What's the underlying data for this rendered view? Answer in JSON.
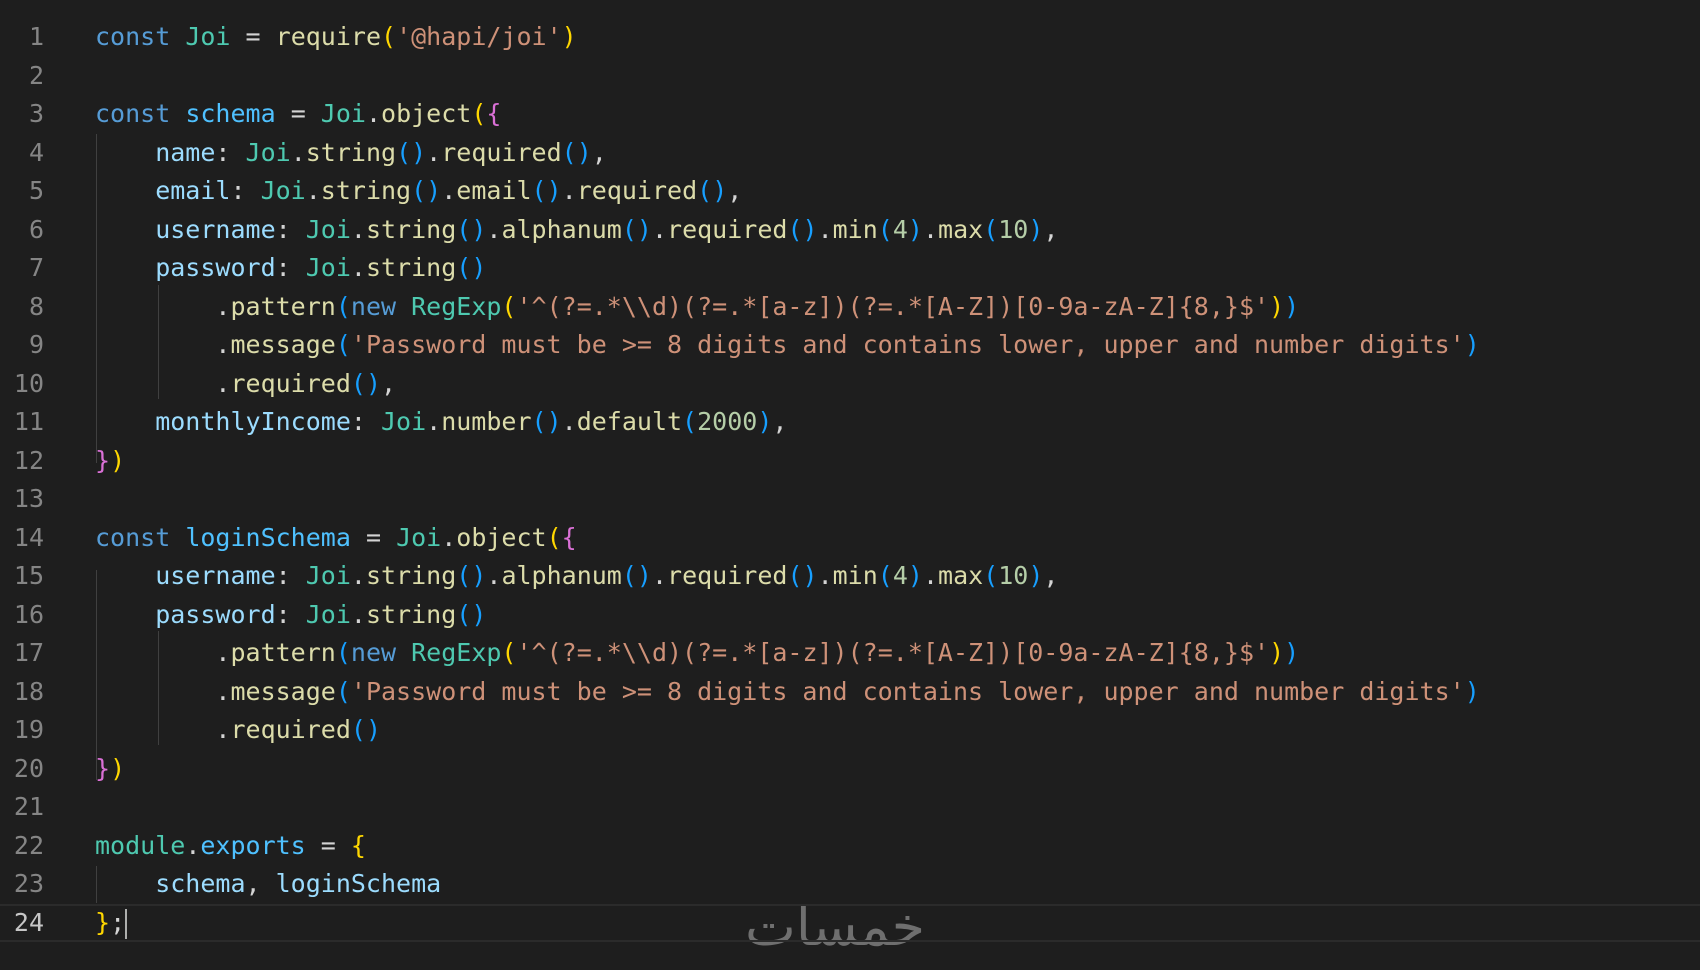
{
  "colors": {
    "background": "#1e1e1e",
    "line_number": "#858585",
    "keyword": "#569cd6",
    "variable": "#9cdcfe",
    "class": "#4ec9b0",
    "function": "#dcdcaa",
    "string": "#ce9178",
    "number": "#b5cea8",
    "text": "#d4d4d4",
    "bracket1": "#ffd700",
    "bracket2": "#da70d6",
    "bracket3": "#179fff"
  },
  "editor": {
    "current_line": 24,
    "lines": [
      {
        "n": "1",
        "t": [
          [
            "const",
            "#569cd6"
          ],
          [
            " ",
            "#d4d4d4"
          ],
          [
            "Joi",
            "#4ec9b0"
          ],
          [
            " = ",
            "#d4d4d4"
          ],
          [
            "require",
            "#dcdcaa"
          ],
          [
            "(",
            "#ffd700"
          ],
          [
            "'@hapi/joi'",
            "#ce9178"
          ],
          [
            ")",
            "#ffd700"
          ]
        ]
      },
      {
        "n": "2",
        "t": []
      },
      {
        "n": "3",
        "t": [
          [
            "const",
            "#569cd6"
          ],
          [
            " ",
            "#d4d4d4"
          ],
          [
            "schema",
            "#4fc1ff"
          ],
          [
            " = ",
            "#d4d4d4"
          ],
          [
            "Joi",
            "#4ec9b0"
          ],
          [
            ".",
            "#d4d4d4"
          ],
          [
            "object",
            "#dcdcaa"
          ],
          [
            "(",
            "#ffd700"
          ],
          [
            "{",
            "#da70d6"
          ]
        ]
      },
      {
        "n": "4",
        "t": [
          [
            "    name",
            "#9cdcfe"
          ],
          [
            ": ",
            "#d4d4d4"
          ],
          [
            "Joi",
            "#4ec9b0"
          ],
          [
            ".",
            "#d4d4d4"
          ],
          [
            "string",
            "#dcdcaa"
          ],
          [
            "()",
            "#179fff"
          ],
          [
            ".",
            "#d4d4d4"
          ],
          [
            "required",
            "#dcdcaa"
          ],
          [
            "()",
            "#179fff"
          ],
          [
            ",",
            "#d4d4d4"
          ]
        ]
      },
      {
        "n": "5",
        "t": [
          [
            "    email",
            "#9cdcfe"
          ],
          [
            ": ",
            "#d4d4d4"
          ],
          [
            "Joi",
            "#4ec9b0"
          ],
          [
            ".",
            "#d4d4d4"
          ],
          [
            "string",
            "#dcdcaa"
          ],
          [
            "()",
            "#179fff"
          ],
          [
            ".",
            "#d4d4d4"
          ],
          [
            "email",
            "#dcdcaa"
          ],
          [
            "()",
            "#179fff"
          ],
          [
            ".",
            "#d4d4d4"
          ],
          [
            "required",
            "#dcdcaa"
          ],
          [
            "()",
            "#179fff"
          ],
          [
            ",",
            "#d4d4d4"
          ]
        ]
      },
      {
        "n": "6",
        "t": [
          [
            "    username",
            "#9cdcfe"
          ],
          [
            ": ",
            "#d4d4d4"
          ],
          [
            "Joi",
            "#4ec9b0"
          ],
          [
            ".",
            "#d4d4d4"
          ],
          [
            "string",
            "#dcdcaa"
          ],
          [
            "()",
            "#179fff"
          ],
          [
            ".",
            "#d4d4d4"
          ],
          [
            "alphanum",
            "#dcdcaa"
          ],
          [
            "()",
            "#179fff"
          ],
          [
            ".",
            "#d4d4d4"
          ],
          [
            "required",
            "#dcdcaa"
          ],
          [
            "()",
            "#179fff"
          ],
          [
            ".",
            "#d4d4d4"
          ],
          [
            "min",
            "#dcdcaa"
          ],
          [
            "(",
            "#179fff"
          ],
          [
            "4",
            "#b5cea8"
          ],
          [
            ")",
            "#179fff"
          ],
          [
            ".",
            "#d4d4d4"
          ],
          [
            "max",
            "#dcdcaa"
          ],
          [
            "(",
            "#179fff"
          ],
          [
            "10",
            "#b5cea8"
          ],
          [
            ")",
            "#179fff"
          ],
          [
            ",",
            "#d4d4d4"
          ]
        ]
      },
      {
        "n": "7",
        "t": [
          [
            "    password",
            "#9cdcfe"
          ],
          [
            ": ",
            "#d4d4d4"
          ],
          [
            "Joi",
            "#4ec9b0"
          ],
          [
            ".",
            "#d4d4d4"
          ],
          [
            "string",
            "#dcdcaa"
          ],
          [
            "()",
            "#179fff"
          ]
        ]
      },
      {
        "n": "8",
        "t": [
          [
            "        .",
            "#d4d4d4"
          ],
          [
            "pattern",
            "#dcdcaa"
          ],
          [
            "(",
            "#179fff"
          ],
          [
            "new",
            "#569cd6"
          ],
          [
            " ",
            "#d4d4d4"
          ],
          [
            "RegExp",
            "#4ec9b0"
          ],
          [
            "(",
            "#ffd700"
          ],
          [
            "'^(?=.*\\\\d)(?=.*[a-z])(?=.*[A-Z])[0-9a-zA-Z]{8,}$'",
            "#ce9178"
          ],
          [
            ")",
            "#ffd700"
          ],
          [
            ")",
            "#179fff"
          ]
        ]
      },
      {
        "n": "9",
        "t": [
          [
            "        .",
            "#d4d4d4"
          ],
          [
            "message",
            "#dcdcaa"
          ],
          [
            "(",
            "#179fff"
          ],
          [
            "'Password must be >= 8 digits and contains lower, upper and number digits'",
            "#ce9178"
          ],
          [
            ")",
            "#179fff"
          ]
        ]
      },
      {
        "n": "10",
        "t": [
          [
            "        .",
            "#d4d4d4"
          ],
          [
            "required",
            "#dcdcaa"
          ],
          [
            "()",
            "#179fff"
          ],
          [
            ",",
            "#d4d4d4"
          ]
        ]
      },
      {
        "n": "11",
        "t": [
          [
            "    monthlyIncome",
            "#9cdcfe"
          ],
          [
            ": ",
            "#d4d4d4"
          ],
          [
            "Joi",
            "#4ec9b0"
          ],
          [
            ".",
            "#d4d4d4"
          ],
          [
            "number",
            "#dcdcaa"
          ],
          [
            "()",
            "#179fff"
          ],
          [
            ".",
            "#d4d4d4"
          ],
          [
            "default",
            "#dcdcaa"
          ],
          [
            "(",
            "#179fff"
          ],
          [
            "2000",
            "#b5cea8"
          ],
          [
            ")",
            "#179fff"
          ],
          [
            ",",
            "#d4d4d4"
          ]
        ]
      },
      {
        "n": "12",
        "t": [
          [
            "}",
            "#da70d6"
          ],
          [
            ")",
            "#ffd700"
          ]
        ]
      },
      {
        "n": "13",
        "t": []
      },
      {
        "n": "14",
        "t": [
          [
            "const",
            "#569cd6"
          ],
          [
            " ",
            "#d4d4d4"
          ],
          [
            "loginSchema",
            "#4fc1ff"
          ],
          [
            " = ",
            "#d4d4d4"
          ],
          [
            "Joi",
            "#4ec9b0"
          ],
          [
            ".",
            "#d4d4d4"
          ],
          [
            "object",
            "#dcdcaa"
          ],
          [
            "(",
            "#ffd700"
          ],
          [
            "{",
            "#da70d6"
          ]
        ]
      },
      {
        "n": "15",
        "t": [
          [
            "    username",
            "#9cdcfe"
          ],
          [
            ": ",
            "#d4d4d4"
          ],
          [
            "Joi",
            "#4ec9b0"
          ],
          [
            ".",
            "#d4d4d4"
          ],
          [
            "string",
            "#dcdcaa"
          ],
          [
            "()",
            "#179fff"
          ],
          [
            ".",
            "#d4d4d4"
          ],
          [
            "alphanum",
            "#dcdcaa"
          ],
          [
            "()",
            "#179fff"
          ],
          [
            ".",
            "#d4d4d4"
          ],
          [
            "required",
            "#dcdcaa"
          ],
          [
            "()",
            "#179fff"
          ],
          [
            ".",
            "#d4d4d4"
          ],
          [
            "min",
            "#dcdcaa"
          ],
          [
            "(",
            "#179fff"
          ],
          [
            "4",
            "#b5cea8"
          ],
          [
            ")",
            "#179fff"
          ],
          [
            ".",
            "#d4d4d4"
          ],
          [
            "max",
            "#dcdcaa"
          ],
          [
            "(",
            "#179fff"
          ],
          [
            "10",
            "#b5cea8"
          ],
          [
            ")",
            "#179fff"
          ],
          [
            ",",
            "#d4d4d4"
          ]
        ]
      },
      {
        "n": "16",
        "t": [
          [
            "    password",
            "#9cdcfe"
          ],
          [
            ": ",
            "#d4d4d4"
          ],
          [
            "Joi",
            "#4ec9b0"
          ],
          [
            ".",
            "#d4d4d4"
          ],
          [
            "string",
            "#dcdcaa"
          ],
          [
            "()",
            "#179fff"
          ]
        ]
      },
      {
        "n": "17",
        "t": [
          [
            "        .",
            "#d4d4d4"
          ],
          [
            "pattern",
            "#dcdcaa"
          ],
          [
            "(",
            "#179fff"
          ],
          [
            "new",
            "#569cd6"
          ],
          [
            " ",
            "#d4d4d4"
          ],
          [
            "RegExp",
            "#4ec9b0"
          ],
          [
            "(",
            "#ffd700"
          ],
          [
            "'^(?=.*\\\\d)(?=.*[a-z])(?=.*[A-Z])[0-9a-zA-Z]{8,}$'",
            "#ce9178"
          ],
          [
            ")",
            "#ffd700"
          ],
          [
            ")",
            "#179fff"
          ]
        ]
      },
      {
        "n": "18",
        "t": [
          [
            "        .",
            "#d4d4d4"
          ],
          [
            "message",
            "#dcdcaa"
          ],
          [
            "(",
            "#179fff"
          ],
          [
            "'Password must be >= 8 digits and contains lower, upper and number digits'",
            "#ce9178"
          ],
          [
            ")",
            "#179fff"
          ]
        ]
      },
      {
        "n": "19",
        "t": [
          [
            "        .",
            "#d4d4d4"
          ],
          [
            "required",
            "#dcdcaa"
          ],
          [
            "()",
            "#179fff"
          ]
        ]
      },
      {
        "n": "20",
        "t": [
          [
            "}",
            "#da70d6"
          ],
          [
            ")",
            "#ffd700"
          ]
        ]
      },
      {
        "n": "21",
        "t": []
      },
      {
        "n": "22",
        "t": [
          [
            "module",
            "#4ec9b0"
          ],
          [
            ".",
            "#d4d4d4"
          ],
          [
            "exports",
            "#4fc1ff"
          ],
          [
            " = ",
            "#d4d4d4"
          ],
          [
            "{",
            "#ffd700"
          ]
        ]
      },
      {
        "n": "23",
        "t": [
          [
            "    schema",
            "#9cdcfe"
          ],
          [
            ", ",
            "#d4d4d4"
          ],
          [
            "loginSchema",
            "#9cdcfe"
          ]
        ]
      },
      {
        "n": "24",
        "t": [
          [
            "}",
            "#ffd700"
          ],
          [
            ";",
            "#d4d4d4"
          ]
        ]
      }
    ]
  },
  "watermark": "خمسات"
}
